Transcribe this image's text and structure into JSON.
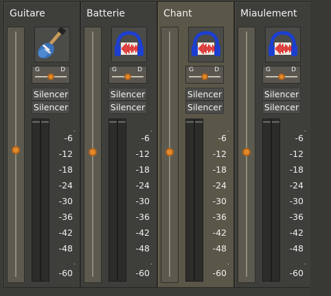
{
  "tracks": [
    {
      "name": "Guitare",
      "icon": "electric-guitar-icon",
      "pan_left": "G",
      "pan_right": "D",
      "pan_value": 0.5,
      "mute_label": "Silencer",
      "solo_label": "Silencer",
      "selected": false,
      "fader_level": 0.52
    },
    {
      "name": "Batterie",
      "icon": "headphones-waveform-icon",
      "pan_left": "G",
      "pan_right": "D",
      "pan_value": 0.5,
      "mute_label": "Silencer",
      "solo_label": "Silencer",
      "selected": false,
      "fader_level": 0.51
    },
    {
      "name": "Chant",
      "icon": "headphones-waveform-icon",
      "pan_left": "G",
      "pan_right": "D",
      "pan_value": 0.5,
      "mute_label": "Silencer",
      "solo_label": "Silencer",
      "selected": true,
      "fader_level": 0.51
    },
    {
      "name": "Miaulement",
      "icon": "headphones-waveform-icon",
      "pan_left": "G",
      "pan_right": "D",
      "pan_value": 0.5,
      "mute_label": "Silencer",
      "solo_label": "Silencer",
      "selected": false,
      "fader_level": 0.51
    }
  ],
  "meter_scale": [
    "-6",
    "-12",
    "-18",
    "-24",
    "-30",
    "-36",
    "-42",
    "-48",
    "-60"
  ],
  "colors": {
    "knob": "#e08a2a",
    "selected_strip": "#5a5648",
    "strip": "#3e3e3b",
    "headphone_blue": "#1c3fd0",
    "waveform_red": "#d81818"
  }
}
